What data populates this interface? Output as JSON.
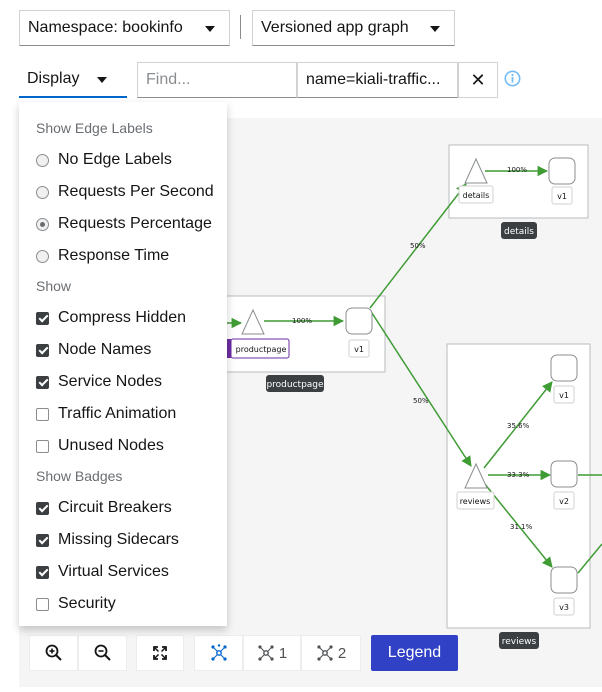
{
  "toolbar": {
    "namespace": "Namespace: bookinfo",
    "graph_type": "Versioned app graph",
    "display": "Display",
    "find_placeholder": "Find...",
    "hide_value": "name=kiali-traffic...",
    "clear": "✕"
  },
  "display_menu": {
    "edge_labels_header": "Show Edge Labels",
    "edge_labels": [
      {
        "label": "No Edge Labels",
        "selected": false
      },
      {
        "label": "Requests Per Second",
        "selected": false
      },
      {
        "label": "Requests Percentage",
        "selected": true
      },
      {
        "label": "Response Time",
        "selected": false
      }
    ],
    "show_header": "Show",
    "show": [
      {
        "label": "Compress Hidden",
        "checked": true
      },
      {
        "label": "Node Names",
        "checked": true
      },
      {
        "label": "Service Nodes",
        "checked": true
      },
      {
        "label": "Traffic Animation",
        "checked": false
      },
      {
        "label": "Unused Nodes",
        "checked": false
      }
    ],
    "badges_header": "Show Badges",
    "badges": [
      {
        "label": "Circuit Breakers",
        "checked": true
      },
      {
        "label": "Missing Sidecars",
        "checked": true
      },
      {
        "label": "Virtual Services",
        "checked": true
      },
      {
        "label": "Security",
        "checked": false
      }
    ]
  },
  "graph": {
    "nodes": {
      "details_service": "details",
      "details_v1": "v1",
      "details_box": "details",
      "productpage_service": "productpage",
      "productpage_v1": "v1",
      "productpage_box": "productpage",
      "reviews_service": "reviews",
      "reviews_v1": "v1",
      "reviews_v2": "v2",
      "reviews_v3": "v3",
      "reviews_box": "reviews"
    },
    "edges": {
      "details_to_v1": "100%",
      "productpage_to_v1": "100%",
      "v1_to_details": "50%",
      "v1_to_reviews": "50%",
      "reviews_to_v1": "35.6%",
      "reviews_to_v2": "33.3%",
      "reviews_to_v3": "31.1%"
    }
  },
  "bottom_toolbar": {
    "layout1": "1",
    "layout2": "2",
    "legend": "Legend"
  },
  "colors": {
    "edge": "#3f9c35",
    "accent": "#0066cc",
    "legend_bg": "#3041c5",
    "badge": "#6d2ea2"
  }
}
